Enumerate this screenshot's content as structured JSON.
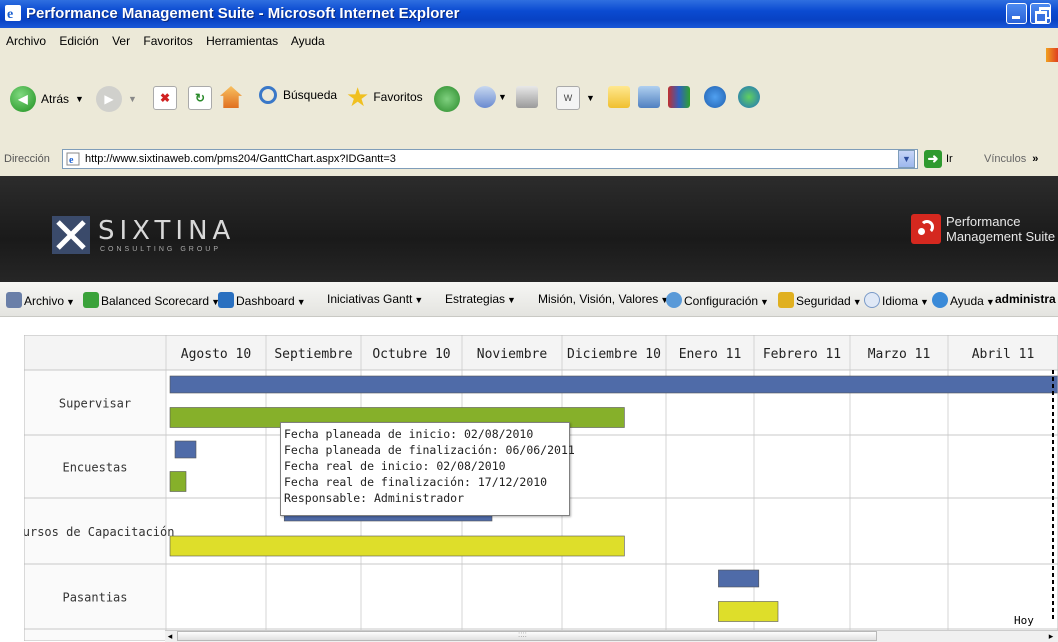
{
  "window": {
    "title": "Performance Management Suite - Microsoft Internet Explorer"
  },
  "menu": [
    "Archivo",
    "Edición",
    "Ver",
    "Favoritos",
    "Herramientas",
    "Ayuda"
  ],
  "toolbar": {
    "back": "Atrás",
    "search": "Búsqueda",
    "favorites": "Favoritos"
  },
  "address": {
    "label": "Dirección",
    "url": "http://www.sixtinaweb.com/pms204/GanttChart.aspx?IDGantt=3",
    "go": "Ir",
    "links": "Vínculos",
    "links_more": "»"
  },
  "brand": {
    "name": "SIXTINA",
    "sub": "CONSULTING GROUP",
    "product_line1": "Performance",
    "product_line2": "Management Suite"
  },
  "appmenu": [
    {
      "label": "Archivo",
      "icon": "save-icon",
      "color": "#6a7fa8"
    },
    {
      "label": "Balanced Scorecard",
      "icon": "scorecard-icon",
      "color": "#3aa23a"
    },
    {
      "label": "Dashboard",
      "icon": "dashboard-icon",
      "color": "#2a70c0"
    },
    {
      "label": "Iniciativas Gantt",
      "icon": "",
      "color": ""
    },
    {
      "label": "Estrategias",
      "icon": "",
      "color": ""
    },
    {
      "label": "Misión, Visión, Valores",
      "icon": "",
      "color": ""
    },
    {
      "label": "Configuración",
      "icon": "gears-icon",
      "color": "#5a9ad8"
    },
    {
      "label": "Seguridad",
      "icon": "lock-icon",
      "color": "#e0b020"
    },
    {
      "label": "Idioma",
      "icon": "globe-icon",
      "color": "#c8d8f0"
    },
    {
      "label": "Ayuda",
      "icon": "help-icon",
      "color": "#3a8ad8"
    }
  ],
  "appmenu_user": "administra",
  "gantt": {
    "months": [
      "Agosto 10",
      "Septiembre",
      "Octubre 10",
      "Noviembre",
      "Diciembre 10",
      "Enero 11",
      "Febrero 11",
      "Marzo 11",
      "Abril 11"
    ],
    "rows": [
      {
        "label": "Supervisar",
        "bars": [
          {
            "kind": "planned",
            "start": 0.0,
            "end": 9.0
          },
          {
            "kind": "real",
            "start": 0.0,
            "end": 4.6
          }
        ]
      },
      {
        "label": "Encuestas",
        "bars": [
          {
            "kind": "planned",
            "start": 0.05,
            "end": 0.3
          },
          {
            "kind": "real",
            "start": 0.0,
            "end": 0.2
          }
        ]
      },
      {
        "label": "Cursos de Capacitación",
        "bars": [
          {
            "kind": "planned",
            "start": 1.15,
            "end": 3.3
          },
          {
            "kind": "real",
            "start": 0.0,
            "end": 4.6
          }
        ]
      },
      {
        "label": "Pasantias",
        "bars": [
          {
            "kind": "planned",
            "start": 5.55,
            "end": 6.05
          },
          {
            "kind": "real",
            "start": 5.55,
            "end": 6.25
          }
        ]
      }
    ],
    "today_label": "Hoy",
    "today_pos": 8.9,
    "colors": {
      "planned": "#4f6ba8",
      "supervisar_real": "#86b02a",
      "encuestas_real": "#86b02a",
      "yellow": "#dede2a"
    }
  },
  "tooltip": [
    "Fecha planeada de inicio: 02/08/2010",
    "Fecha planeada de finalización: 06/06/2011",
    "Fecha real de inicio: 02/08/2010",
    "Fecha real de finalización: 17/12/2010",
    "Responsable: Administrador"
  ],
  "statusbar": {
    "scroll_dots": "::::"
  }
}
